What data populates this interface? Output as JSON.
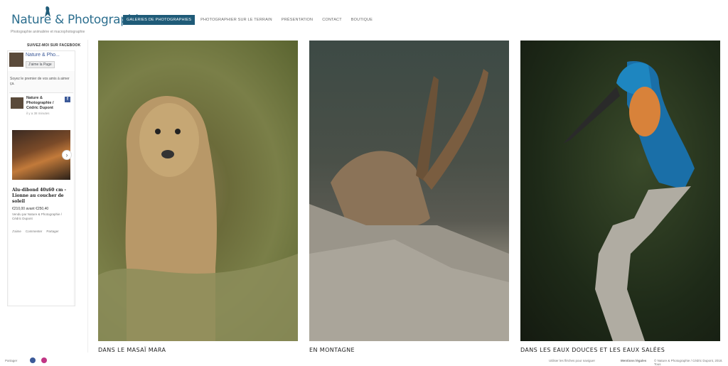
{
  "site": {
    "logo": "Nature & Photographie",
    "tagline": "Photographie animalière et macrophotographie"
  },
  "nav": {
    "items": [
      "GALERIES DE PHOTOGRAPHIES",
      "PHOTOGRAPHIER SUR LE TERRAIN",
      "PRÉSENTATION",
      "CONTACT",
      "BOUTIQUE"
    ]
  },
  "sidebar": {
    "title": "SUIVEZ-MOI SUR FACEBOOK",
    "page_name": "Nature & Pho...",
    "like_label": "J'aime la Page",
    "friends_text": "Soyez le premier de vos amis à aimer ça.",
    "post_author": "Nature & Photographie / Cédric Dupont",
    "post_time": "il y a 38 minutes",
    "product_title": "Alu-dibond 40x60 cm - Lionne au coucher de soleil",
    "price": "€210,00 avant €250,40",
    "seller": "Vendu par Nature & Photographie / Cédric Dupont",
    "actions": [
      "J'aime",
      "Commenter",
      "Partager"
    ]
  },
  "gallery": {
    "items": [
      {
        "caption": "DANS LE MASAÏ MARA"
      },
      {
        "caption": "EN MONTAGNE"
      },
      {
        "caption": "DANS LES EAUX DOUCES ET LES EAUX SALÉES"
      }
    ]
  },
  "footer": {
    "share": "Partager",
    "nav_hint": "Utiliser les flèches pour naviguer",
    "legal": "Mentions légales",
    "copyright": "© Nature & Photographie / Cédric Dupont, 2018. Tous"
  }
}
